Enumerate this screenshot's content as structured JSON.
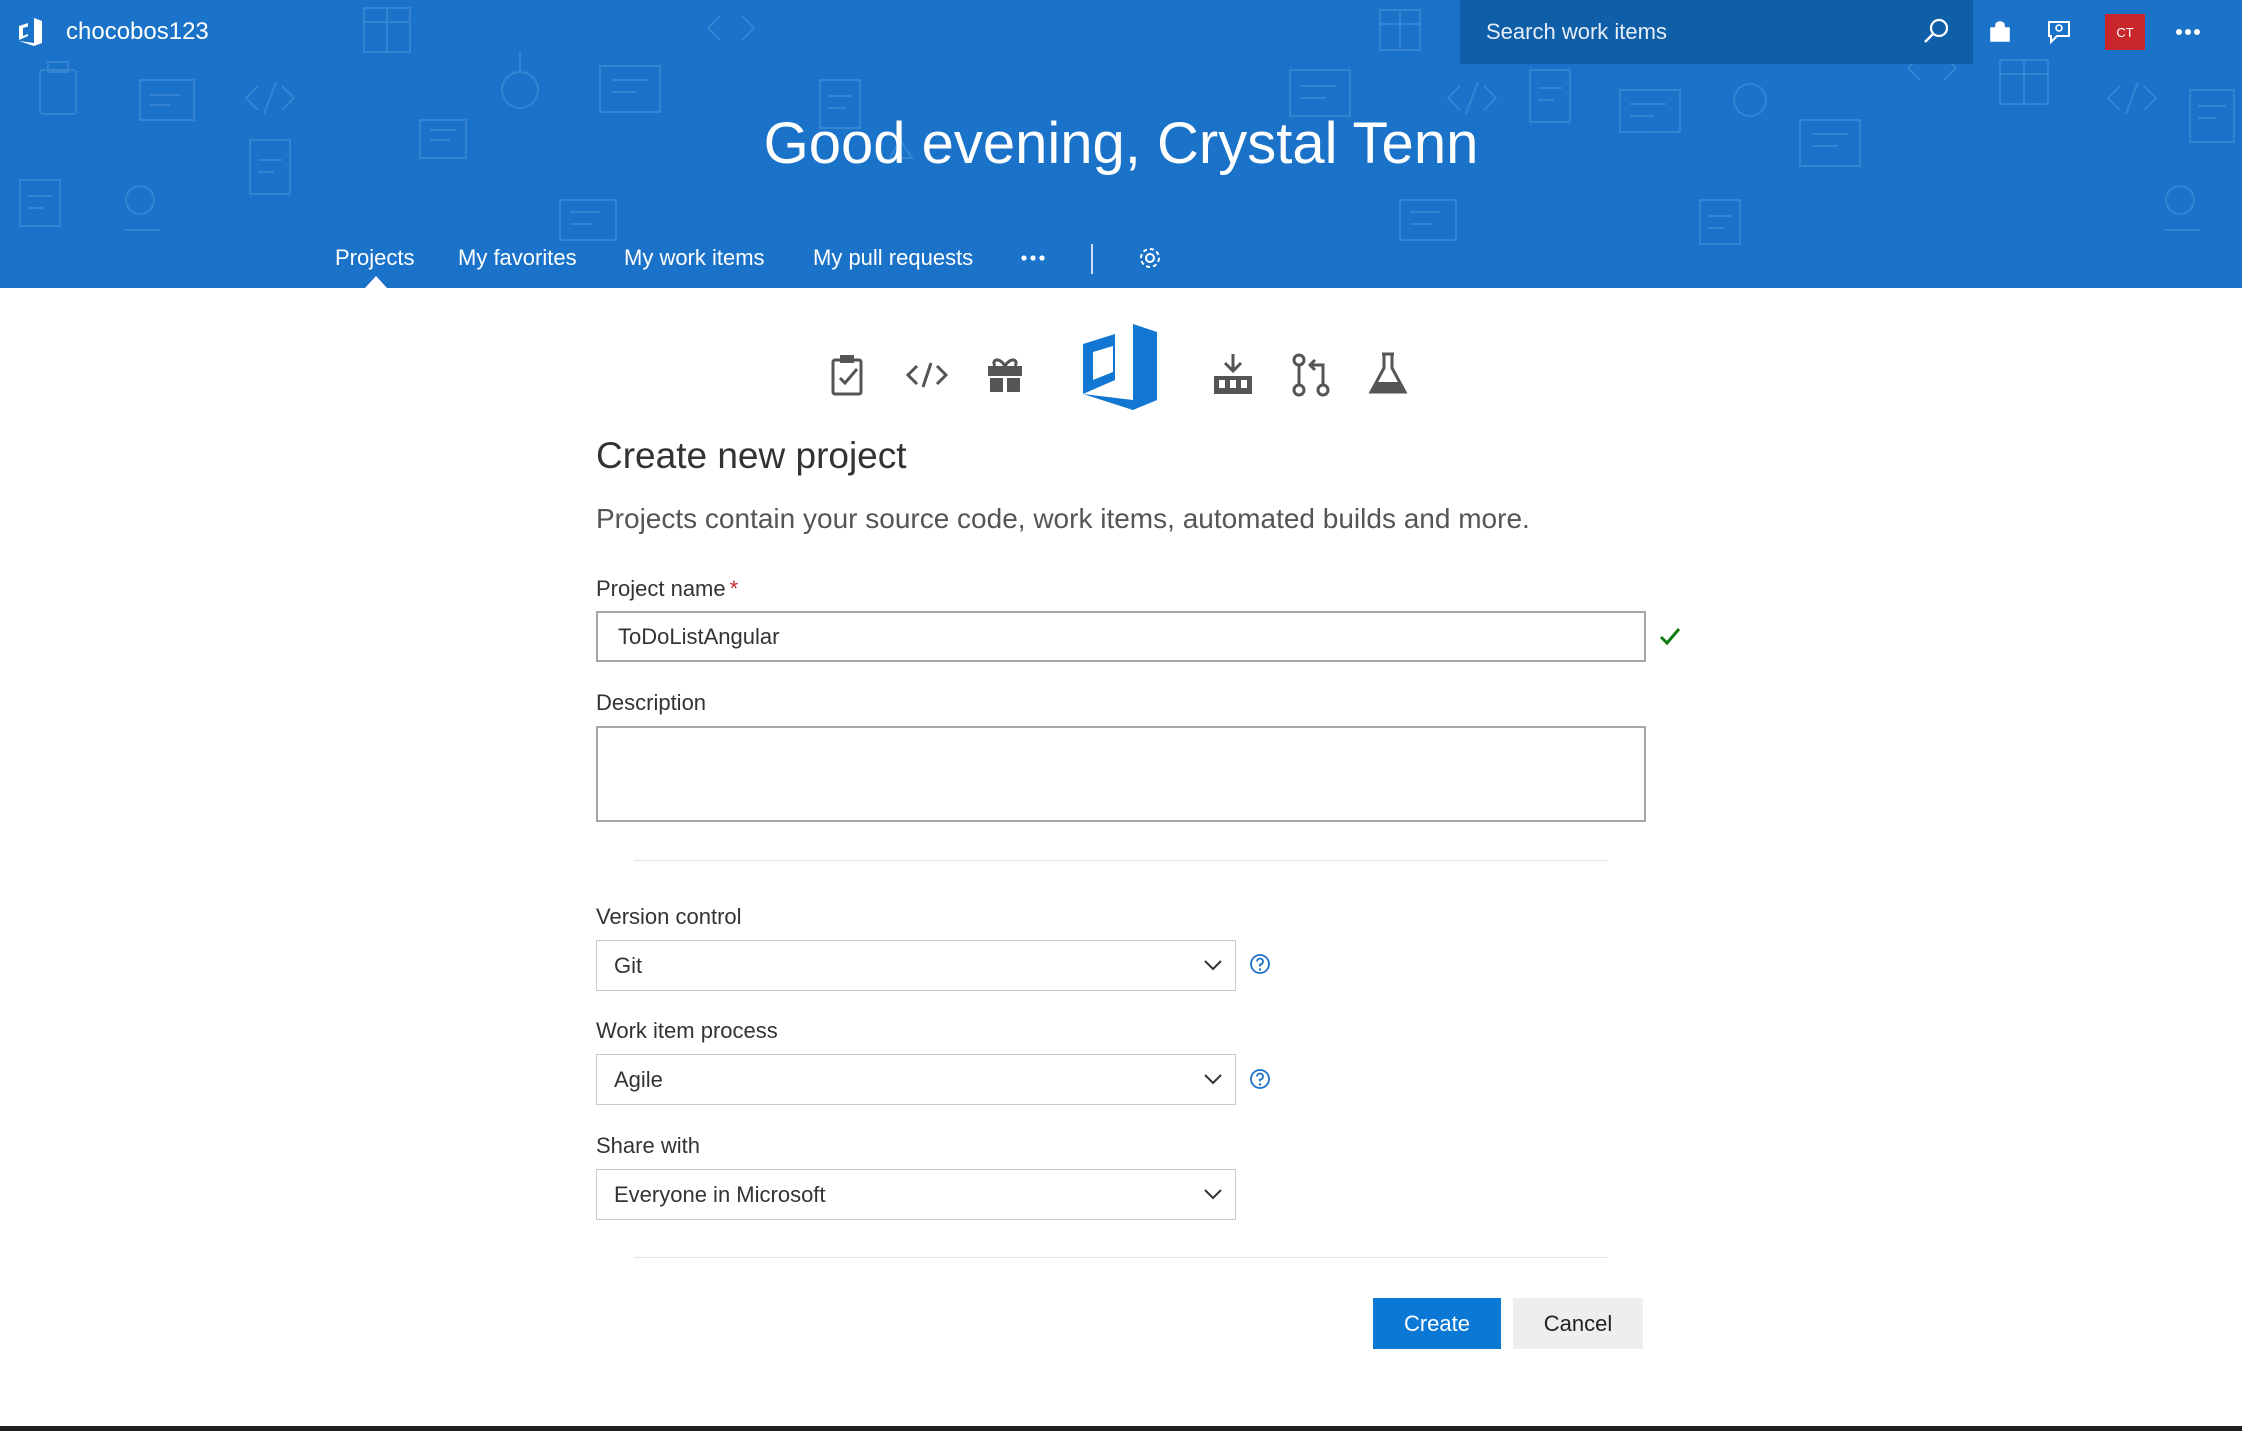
{
  "account": {
    "name": "chocobos123"
  },
  "search": {
    "placeholder": "Search work items"
  },
  "user": {
    "initials": "CT"
  },
  "greeting": "Good evening, Crystal Tenn",
  "nav": {
    "items": [
      {
        "label": "Projects",
        "active": true
      },
      {
        "label": "My favorites",
        "active": false
      },
      {
        "label": "My work items",
        "active": false
      },
      {
        "label": "My pull requests",
        "active": false
      }
    ],
    "more_icon": "more-icon",
    "settings_icon": "gear-icon"
  },
  "services": {
    "icons": [
      "boards-icon",
      "code-icon",
      "artifacts-gift-icon",
      "vsts-logo",
      "build-icon",
      "pull-request-icon",
      "test-flask-icon"
    ]
  },
  "form": {
    "title": "Create new project",
    "subtitle": "Projects contain your source code, work items, automated builds and more.",
    "project_name": {
      "label": "Project name",
      "required_marker": "*",
      "value": "ToDoListAngular",
      "valid": true
    },
    "description": {
      "label": "Description",
      "value": ""
    },
    "version_control": {
      "label": "Version control",
      "value": "Git"
    },
    "work_item_process": {
      "label": "Work item process",
      "value": "Agile"
    },
    "share_with": {
      "label": "Share with",
      "value": "Everyone in Microsoft"
    },
    "buttons": {
      "create": "Create",
      "cancel": "Cancel"
    }
  },
  "colors": {
    "banner": "#1a73c9",
    "search_bg": "#0f5ea8",
    "primary": "#0a78d4",
    "avatar": "#c8262b",
    "valid": "#107c10"
  }
}
